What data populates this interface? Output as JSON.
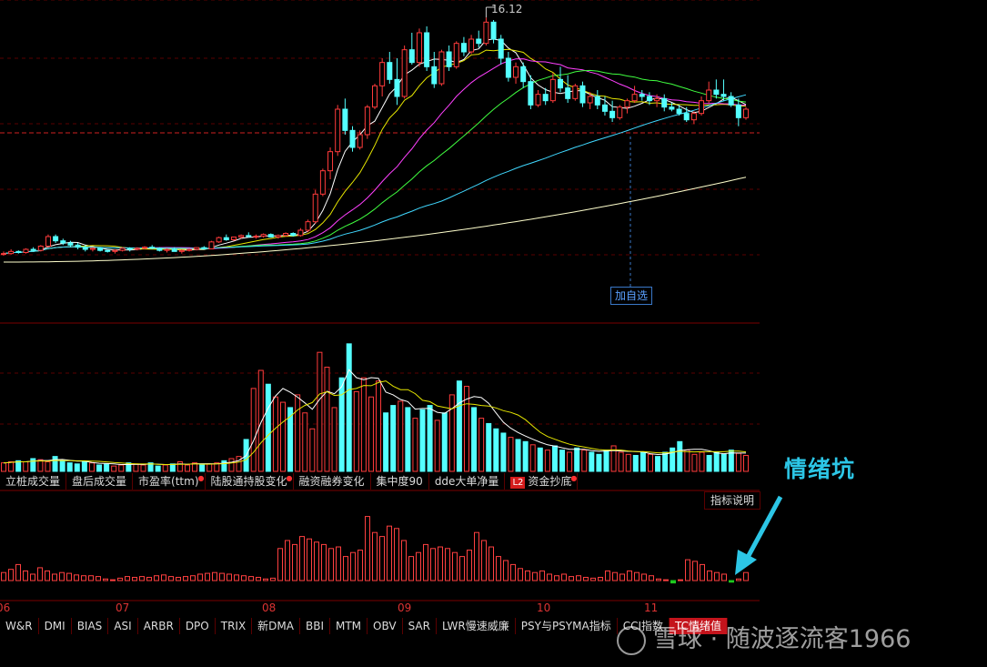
{
  "chart_data": [
    {
      "type": "candlestick",
      "peak_label": "16.12",
      "reference_price_label": "",
      "ma_colors": [
        "#ffffff",
        "#e6e600",
        "#ff40ff",
        "#40ff40",
        "#40d8ff",
        "#ffffcc"
      ],
      "candles": [
        [
          5.0,
          5.1,
          4.9,
          5.0
        ],
        [
          5.0,
          5.2,
          4.95,
          5.1
        ],
        [
          5.1,
          5.15,
          5.0,
          5.05
        ],
        [
          5.05,
          5.25,
          5.0,
          5.2
        ],
        [
          5.2,
          5.3,
          5.1,
          5.15
        ],
        [
          5.15,
          5.4,
          5.1,
          5.35
        ],
        [
          5.35,
          5.9,
          5.3,
          5.8
        ],
        [
          5.8,
          5.9,
          5.5,
          5.6
        ],
        [
          5.6,
          5.7,
          5.4,
          5.5
        ],
        [
          5.5,
          5.6,
          5.3,
          5.4
        ],
        [
          5.4,
          5.5,
          5.2,
          5.3
        ],
        [
          5.3,
          5.4,
          5.1,
          5.2
        ],
        [
          5.2,
          5.3,
          5.1,
          5.25
        ],
        [
          5.25,
          5.3,
          5.1,
          5.15
        ],
        [
          5.15,
          5.2,
          5.05,
          5.1
        ],
        [
          5.1,
          5.2,
          5.0,
          5.15
        ],
        [
          5.15,
          5.3,
          5.1,
          5.25
        ],
        [
          5.25,
          5.3,
          5.1,
          5.2
        ],
        [
          5.2,
          5.3,
          5.15,
          5.25
        ],
        [
          5.25,
          5.35,
          5.2,
          5.3
        ],
        [
          5.3,
          5.4,
          5.2,
          5.25
        ],
        [
          5.25,
          5.3,
          5.1,
          5.15
        ],
        [
          5.15,
          5.25,
          5.05,
          5.2
        ],
        [
          5.2,
          5.3,
          5.1,
          5.1
        ],
        [
          5.1,
          5.2,
          5.0,
          5.15
        ],
        [
          5.15,
          5.25,
          5.1,
          5.2
        ],
        [
          5.2,
          5.3,
          5.15,
          5.28
        ],
        [
          5.28,
          5.35,
          5.2,
          5.22
        ],
        [
          5.22,
          5.6,
          5.2,
          5.55
        ],
        [
          5.55,
          5.8,
          5.5,
          5.75
        ],
        [
          5.75,
          5.9,
          5.6,
          5.65
        ],
        [
          5.65,
          5.8,
          5.6,
          5.78
        ],
        [
          5.78,
          5.9,
          5.7,
          5.85
        ],
        [
          5.85,
          6.0,
          5.75,
          5.8
        ],
        [
          5.8,
          5.9,
          5.7,
          5.82
        ],
        [
          5.82,
          5.95,
          5.75,
          5.9
        ],
        [
          5.9,
          5.95,
          5.75,
          5.78
        ],
        [
          5.78,
          5.9,
          5.7,
          5.85
        ],
        [
          5.85,
          6.0,
          5.8,
          5.95
        ],
        [
          5.95,
          6.0,
          5.8,
          5.85
        ],
        [
          5.85,
          6.2,
          5.8,
          6.1
        ],
        [
          6.1,
          6.6,
          6.0,
          6.5
        ],
        [
          6.5,
          8.0,
          6.4,
          7.8
        ],
        [
          7.8,
          9.0,
          7.7,
          8.9
        ],
        [
          8.9,
          10.0,
          8.5,
          9.8
        ],
        [
          9.8,
          12.0,
          9.6,
          11.8
        ],
        [
          11.8,
          12.3,
          10.6,
          10.8
        ],
        [
          10.8,
          11.0,
          9.8,
          10.0
        ],
        [
          10.0,
          10.8,
          9.9,
          10.6
        ],
        [
          10.6,
          12.0,
          10.4,
          11.9
        ],
        [
          11.9,
          13.0,
          11.8,
          12.9
        ],
        [
          12.9,
          14.2,
          12.4,
          14.0
        ],
        [
          14.0,
          14.5,
          13.0,
          13.2
        ],
        [
          13.2,
          14.2,
          12.0,
          12.4
        ],
        [
          12.4,
          14.8,
          12.3,
          14.6
        ],
        [
          14.6,
          15.4,
          13.9,
          14.0
        ],
        [
          14.0,
          15.6,
          13.8,
          15.4
        ],
        [
          15.4,
          15.7,
          13.6,
          13.8
        ],
        [
          13.8,
          14.5,
          12.8,
          13.0
        ],
        [
          13.0,
          14.6,
          12.9,
          14.5
        ],
        [
          14.5,
          14.8,
          13.6,
          13.8
        ],
        [
          13.8,
          15.0,
          13.7,
          14.9
        ],
        [
          14.9,
          15.2,
          14.3,
          14.5
        ],
        [
          14.5,
          15.3,
          14.4,
          15.1
        ],
        [
          15.1,
          15.5,
          14.7,
          14.9
        ],
        [
          14.9,
          16.12,
          14.8,
          15.9
        ],
        [
          15.9,
          16.0,
          14.9,
          15.1
        ],
        [
          15.1,
          15.3,
          13.9,
          14.2
        ],
        [
          14.2,
          14.5,
          13.1,
          13.3
        ],
        [
          13.3,
          14.0,
          13.0,
          13.8
        ],
        [
          13.8,
          14.0,
          12.8,
          13.1
        ],
        [
          13.1,
          13.4,
          11.8,
          12.0
        ],
        [
          12.0,
          12.7,
          11.9,
          12.5
        ],
        [
          12.5,
          12.8,
          12.0,
          12.2
        ],
        [
          12.2,
          13.5,
          12.1,
          13.2
        ],
        [
          13.2,
          13.8,
          12.6,
          12.8
        ],
        [
          12.8,
          13.4,
          12.1,
          12.3
        ],
        [
          12.3,
          13.0,
          12.2,
          12.9
        ],
        [
          12.9,
          13.1,
          11.9,
          12.1
        ],
        [
          12.1,
          12.6,
          11.8,
          12.4
        ],
        [
          12.4,
          12.7,
          11.8,
          12.0
        ],
        [
          12.0,
          12.4,
          11.5,
          11.7
        ],
        [
          11.7,
          12.2,
          11.2,
          11.4
        ],
        [
          11.4,
          12.0,
          11.3,
          11.9
        ],
        [
          11.9,
          12.3,
          11.6,
          12.2
        ],
        [
          12.2,
          12.9,
          12.1,
          12.5
        ],
        [
          12.5,
          12.7,
          12.2,
          12.4
        ],
        [
          12.4,
          12.6,
          12.0,
          12.2
        ],
        [
          12.2,
          12.5,
          11.9,
          12.3
        ],
        [
          12.3,
          12.5,
          11.7,
          11.9
        ],
        [
          11.9,
          12.1,
          11.7,
          11.8
        ],
        [
          11.8,
          12.0,
          11.5,
          11.6
        ],
        [
          11.6,
          11.9,
          11.2,
          11.3
        ],
        [
          11.3,
          11.7,
          11.1,
          11.6
        ],
        [
          11.6,
          12.4,
          11.5,
          12.2
        ],
        [
          12.2,
          13.1,
          12.1,
          12.7
        ],
        [
          12.7,
          13.2,
          12.3,
          12.5
        ],
        [
          12.5,
          13.2,
          12.2,
          12.4
        ],
        [
          12.4,
          12.6,
          11.9,
          12.0
        ],
        [
          12.0,
          12.3,
          11.0,
          11.4
        ],
        [
          11.4,
          11.9,
          11.3,
          11.8
        ]
      ]
    },
    {
      "type": "bar",
      "name": "volume",
      "values": [
        8,
        9,
        10,
        9,
        12,
        11,
        9,
        14,
        10,
        8,
        7,
        9,
        8,
        6,
        7,
        5,
        6,
        8,
        7,
        6,
        8,
        5,
        6,
        7,
        9,
        6,
        8,
        6,
        7,
        8,
        10,
        12,
        14,
        30,
        78,
        95,
        82,
        70,
        65,
        60,
        72,
        55,
        40,
        112,
        98,
        60,
        88,
        120,
        75,
        88,
        70,
        85,
        55,
        62,
        66,
        60,
        50,
        58,
        62,
        48,
        55,
        72,
        85,
        80,
        60,
        50,
        45,
        40,
        36,
        32,
        30,
        28,
        25,
        22,
        20,
        24,
        20,
        18,
        22,
        20,
        18,
        16,
        20,
        24,
        18,
        16,
        15,
        18,
        16,
        14,
        18,
        22,
        28,
        20,
        16,
        18,
        15,
        18,
        16,
        20,
        17,
        15
      ]
    },
    {
      "type": "bar",
      "name": "sentiment",
      "values": [
        10,
        14,
        20,
        12,
        8,
        16,
        12,
        8,
        10,
        9,
        7,
        6,
        6,
        5,
        2,
        1,
        3,
        5,
        4,
        5,
        4,
        6,
        7,
        5,
        4,
        5,
        6,
        8,
        9,
        10,
        9,
        8,
        7,
        6,
        5,
        4,
        2,
        3,
        40,
        50,
        45,
        55,
        52,
        48,
        45,
        40,
        42,
        30,
        35,
        38,
        80,
        60,
        55,
        68,
        65,
        50,
        30,
        35,
        45,
        40,
        42,
        40,
        35,
        30,
        38,
        60,
        50,
        42,
        30,
        25,
        20,
        15,
        12,
        10,
        12,
        8,
        6,
        8,
        5,
        6,
        4,
        3,
        4,
        12,
        10,
        8,
        12,
        10,
        8,
        6,
        2,
        1,
        -3,
        1,
        26,
        24,
        20,
        12,
        10,
        8,
        -2,
        2,
        10
      ]
    }
  ],
  "tabs_top": [
    {
      "label": "立桩成交量"
    },
    {
      "label": "盘后成交量"
    },
    {
      "label": "市盈率(ttm)",
      "dot": "●"
    },
    {
      "label": "陆股通持股变化",
      "dot": "●"
    },
    {
      "label": "融资融券变化"
    },
    {
      "label": "集中度90"
    },
    {
      "label": "dde大单净量"
    },
    {
      "label": "资金抄底",
      "badge": "L2",
      "dot": "●"
    }
  ],
  "tabs_bottom": [
    {
      "label": "W&R"
    },
    {
      "label": "DMI"
    },
    {
      "label": "BIAS"
    },
    {
      "label": "ASI"
    },
    {
      "label": "ARBR"
    },
    {
      "label": "DPO"
    },
    {
      "label": "TRIX"
    },
    {
      "label": "新DMA"
    },
    {
      "label": "BBI"
    },
    {
      "label": "MTM"
    },
    {
      "label": "OBV"
    },
    {
      "label": "SAR"
    },
    {
      "label": "LWR慢速威廉"
    },
    {
      "label": "PSY与PSYMA指标"
    },
    {
      "label": "CCI指数"
    },
    {
      "label": "TC情绪值",
      "active": true
    }
  ],
  "explain_button": "指标说明",
  "add_favorite": "加自选",
  "annotation": "情绪坑",
  "watermark": "雪球 · 随波逐流客1966",
  "months": [
    "06",
    "07",
    "08",
    "09",
    "10",
    "11"
  ],
  "colors": {
    "up": "#ff3b3b",
    "down": "#54ffff",
    "grid": "#5a0000",
    "annotation": "#2cc6e6"
  }
}
